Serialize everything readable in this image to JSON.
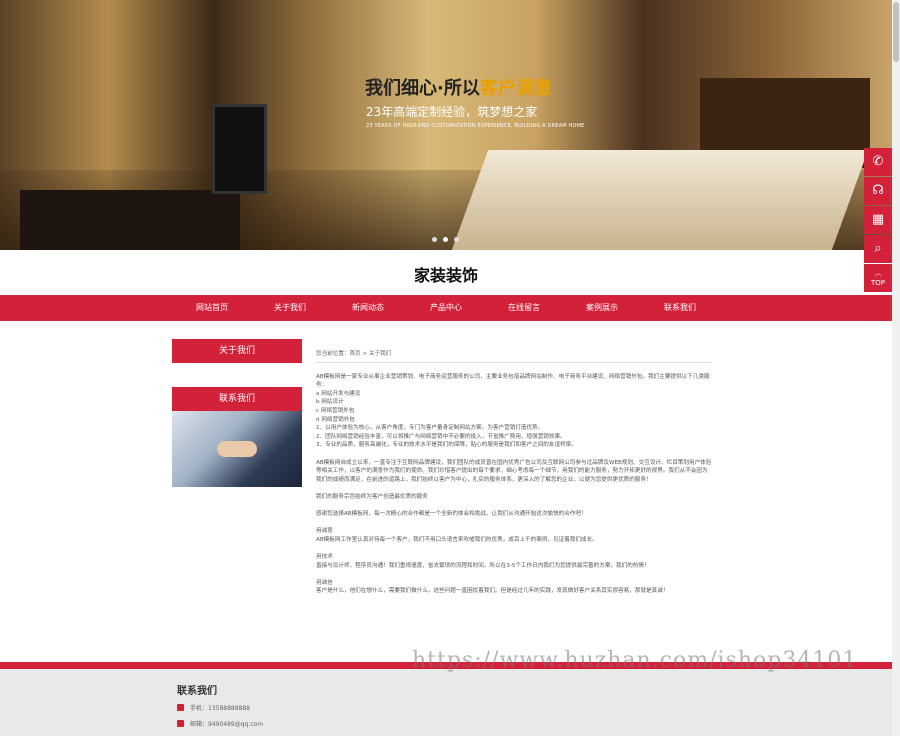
{
  "banner": {
    "title_main": "我们细心·所以",
    "title_highlight": "客户满意",
    "subtitle": "23年高端定制经验，筑梦想之家",
    "subtitle_en": "23 YEARS OF HIGH-END CUSTOMIZATION EXPERIENCE, BUILDING A DREAM HOME",
    "slides": 3,
    "active_slide": 1
  },
  "site_title": "家装装饰",
  "nav": [
    "网站首页",
    "关于我们",
    "新闻动态",
    "产品中心",
    "在线留言",
    "案例展示",
    "联系我们"
  ],
  "sidebar": {
    "about_title": "关于我们",
    "contact_title": "联系我们"
  },
  "breadcrumb": "您当前位置：首页 > 关于我们",
  "content": [
    "AB模板网是一家专业从事企业营销策划、电子商务运营服务的公司，主要业务包括品牌网站制作、电子商务平台建设、网络营销外包。我们主要提供以下几类服务：",
    "a 网站开发与建设",
    "b 网站设计",
    "c 网络营销外包",
    "d 网络营销外包",
    "1、以用户体验为核心，从客户角度，专门为客户量身定制网站方案，为客户营销打造优势。",
    "2、团队网络营销经验丰富，可以将推广与网络营销中不必要的投入，节省推广费用，增强营销效果。",
    "3、专业的品质，服务高端化，专业的技术水平是我们的保障，贴心的服务是我们和客户之间的友谊桥梁。",
    "",
    "AB模板网自成立以来，一直专注于互联网品牌建设，我们团队的成员曾在国内优秀广告公司及互联网公司参与过品牌及WEB规划、交互设计、栏目策划用户体验等相关工作，以客户的满意作为我们的使命。我们珍惜客户提出的每个要求，细心考虑每一个细节，用我们的能力服务，努力开拓更好的视界。我们从不会因为我们的成绩而满足，在前进的道路上，我们始终以客户为中心，扎实的服务体系，更深入的了解您的企业，以便为您提供更优质的服务！",
    "",
    "我们的服务宗旨始终为客户创造最优质的服务",
    "",
    "感谢您选择AB模板网，每一次精心的合作都是一个全新的体会和挑战，让我们从沟通开始这次愉快的合作吧！",
    "",
    "用诚意",
    "AB模板网工作室认真对待每一个客户，我们不用口头语言来吹嘘我们的优秀，成百上千的案例，见证着我们成长。",
    "",
    "用技术",
    "直接与设计师、程序员沟通！我们重视速度，省去繁琐的流程和时间，所以在3-5个工作日内我们为您提供最完善的方案，我们的热情！",
    "",
    "用诚信",
    "客户是什么，他们在想什么，需要我们做什么，这些问题一直困扰着我们。但是经过几年的实践，发现做好客户关系其实很容易，那就是真诚！"
  ],
  "footer": {
    "title": "联系我们",
    "phone": "手机：13588888888",
    "email": "邮箱：9490489@qq.com"
  },
  "tools": {
    "phone": "phone-icon",
    "service": "headset-icon",
    "qr": "qrcode-icon",
    "search": "search-icon",
    "top_label": "TOP"
  },
  "watermark": "https://www.huzhan.com/ishop34101",
  "colors": {
    "accent": "#d3213a",
    "highlight": "#e8a000"
  }
}
